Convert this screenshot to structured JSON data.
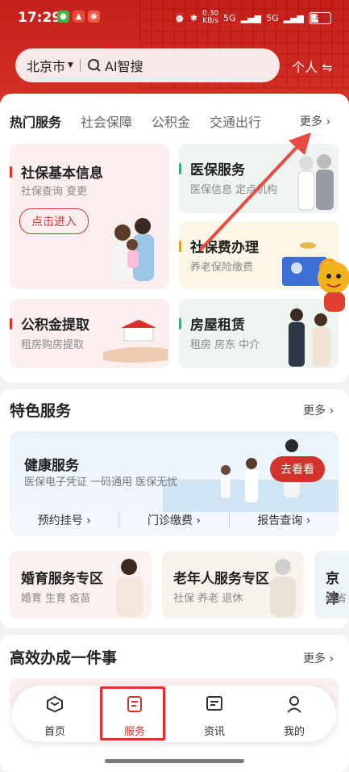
{
  "status": {
    "time": "17:29",
    "net_speed": "0.30",
    "net_unit": "KB/s",
    "signal1": "5G",
    "signal2": "5G",
    "battery": "33"
  },
  "search": {
    "city": "北京市",
    "ai_label": "AI智搜"
  },
  "header": {
    "person_switch": "个人"
  },
  "tabs": [
    {
      "label": "热门服务",
      "active": true
    },
    {
      "label": "社会保障"
    },
    {
      "label": "公积金"
    },
    {
      "label": "交通出行"
    }
  ],
  "hot_more": "更多",
  "tiles": {
    "shebao": {
      "title": "社保基本信息",
      "sub": "社保查询 变更",
      "button": "点击进入"
    },
    "yibao": {
      "title": "医保服务",
      "sub": "医保信息 定点机构"
    },
    "fee": {
      "title": "社保费办理",
      "sub": "养老保险缴费"
    },
    "gjj": {
      "title": "公积金提取",
      "sub": "租房购房提取"
    },
    "rent": {
      "title": "房屋租赁",
      "sub": "租房 房东 中介"
    }
  },
  "special": {
    "title": "特色服务",
    "more": "更多",
    "health": {
      "title": "健康服务",
      "sub": "医保电子凭证 一码通用 医保无忧",
      "button": "去看看"
    },
    "links": [
      "预约挂号",
      "门诊缴费",
      "报告查询"
    ],
    "zones": [
      {
        "title": "婚育服务专区",
        "sub": "婚育 生育 疫苗"
      },
      {
        "title": "老年人服务专区",
        "sub": "社保 养老 退休"
      },
      {
        "title": "京津",
        "sub": "跨省"
      }
    ]
  },
  "efficient": {
    "title": "高效办成一件事",
    "more": "更多"
  },
  "nav": [
    {
      "label": "首页"
    },
    {
      "label": "服务",
      "active": true
    },
    {
      "label": "资讯"
    },
    {
      "label": "我的"
    }
  ],
  "colors": {
    "brand": "#c6201c",
    "accent": "#d1342c",
    "highlight": "#e0332d"
  }
}
